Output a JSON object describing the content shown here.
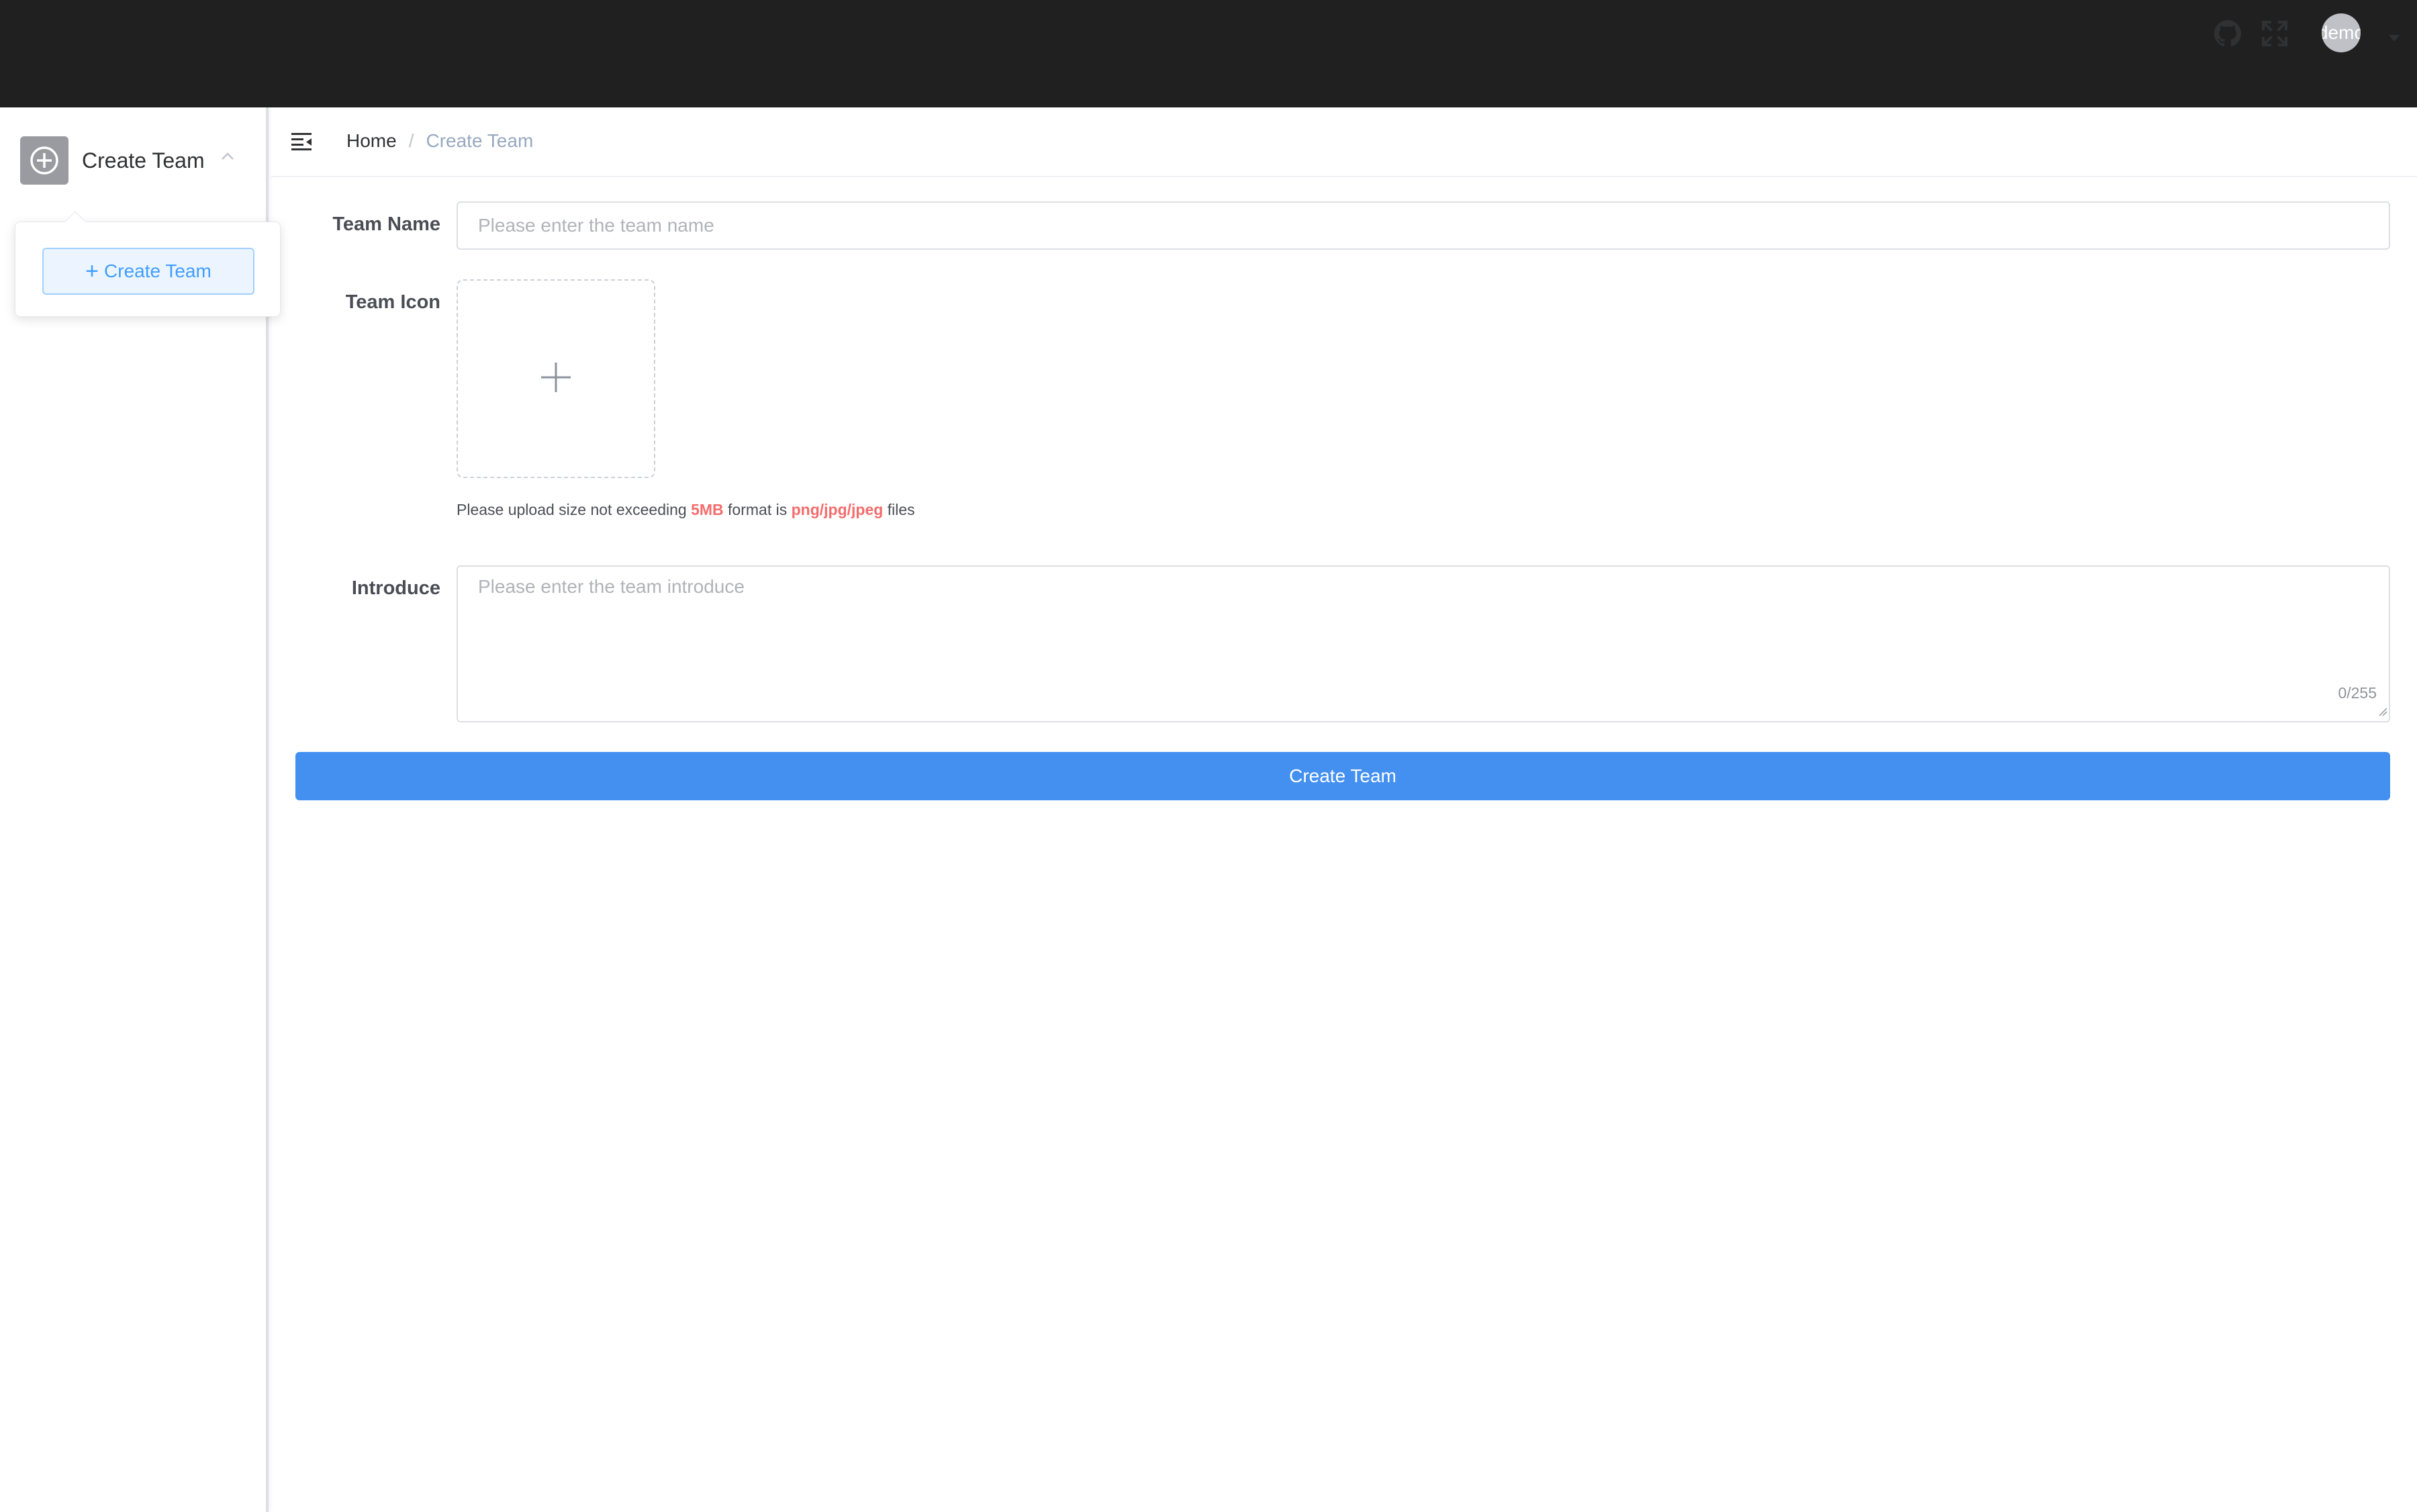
{
  "sidebar": {
    "team_switcher": {
      "label": "Create Team",
      "icon": "plus-circle-icon"
    },
    "popover": {
      "create_button_label": "Create Team"
    }
  },
  "navbar": {
    "breadcrumb": {
      "home": "Home",
      "separator": "/",
      "current": "Create Team"
    },
    "user_avatar_text": "demo",
    "icons": [
      "hamburger-icon",
      "github-icon",
      "fullscreen-icon",
      "chevron-down-icon"
    ]
  },
  "form": {
    "team_name": {
      "label": "Team Name",
      "placeholder": "Please enter the team name",
      "value": ""
    },
    "team_icon": {
      "label": "Team Icon",
      "tip_prefix": "Please upload size not exceeding",
      "tip_size": "5MB",
      "tip_middle": "format is",
      "tip_formats": "png/jpg/jpeg",
      "tip_suffix": "files"
    },
    "introduce": {
      "label": "Introduce",
      "placeholder": "Please enter the team introduce",
      "value": "",
      "counter": "0/255"
    },
    "submit_label": "Create Team"
  },
  "colors": {
    "topbar": "#202020",
    "primary": "#4390f1",
    "highlight": "#f56c6c",
    "breadcrumb_current": "#97a8be"
  }
}
